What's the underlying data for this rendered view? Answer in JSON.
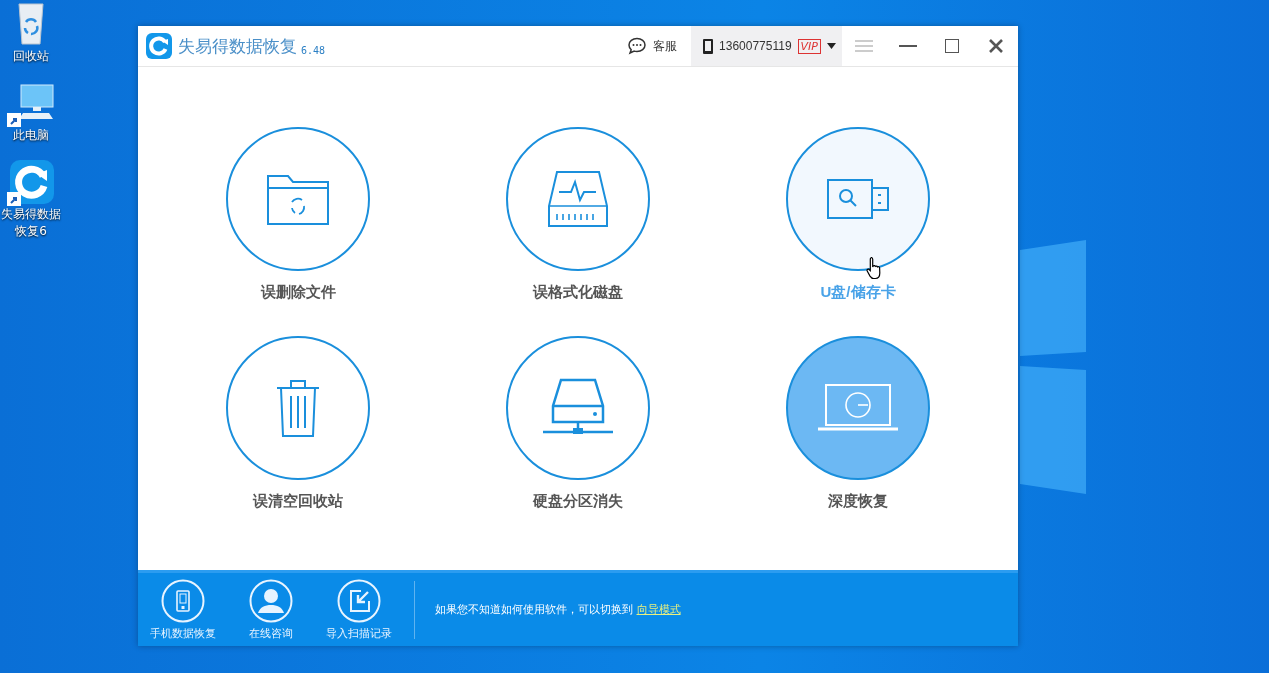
{
  "desktop_icons": [
    {
      "label": "回收站",
      "kind": "recycle-bin",
      "shortcut": false
    },
    {
      "label": "此电脑",
      "kind": "computer",
      "shortcut": true
    },
    {
      "label": "失易得数据恢复6",
      "kind": "app",
      "shortcut": true
    }
  ],
  "window": {
    "title": "失易得数据恢复",
    "version": "6.48",
    "support": "客服",
    "phone": "13600775119",
    "badge": "VIP"
  },
  "tiles": [
    {
      "label": "误删除文件",
      "kind": "folder",
      "hovered": false,
      "selected": false
    },
    {
      "label": "误格式化磁盘",
      "kind": "disk",
      "hovered": false,
      "selected": false
    },
    {
      "label": "U盘/储存卡",
      "kind": "usb",
      "hovered": true,
      "selected": false
    },
    {
      "label": "误清空回收站",
      "kind": "trash",
      "hovered": false,
      "selected": false
    },
    {
      "label": "硬盘分区消失",
      "kind": "server",
      "hovered": false,
      "selected": false
    },
    {
      "label": "深度恢复",
      "kind": "laptop",
      "hovered": false,
      "selected": true
    }
  ],
  "footer": {
    "buttons": [
      {
        "label": "手机数据恢复",
        "kind": "phone"
      },
      {
        "label": "在线咨询",
        "kind": "person"
      },
      {
        "label": "导入扫描记录",
        "kind": "import"
      }
    ],
    "hint": "如果您不知道如何使用软件，可以切换到",
    "link": "向导模式"
  }
}
